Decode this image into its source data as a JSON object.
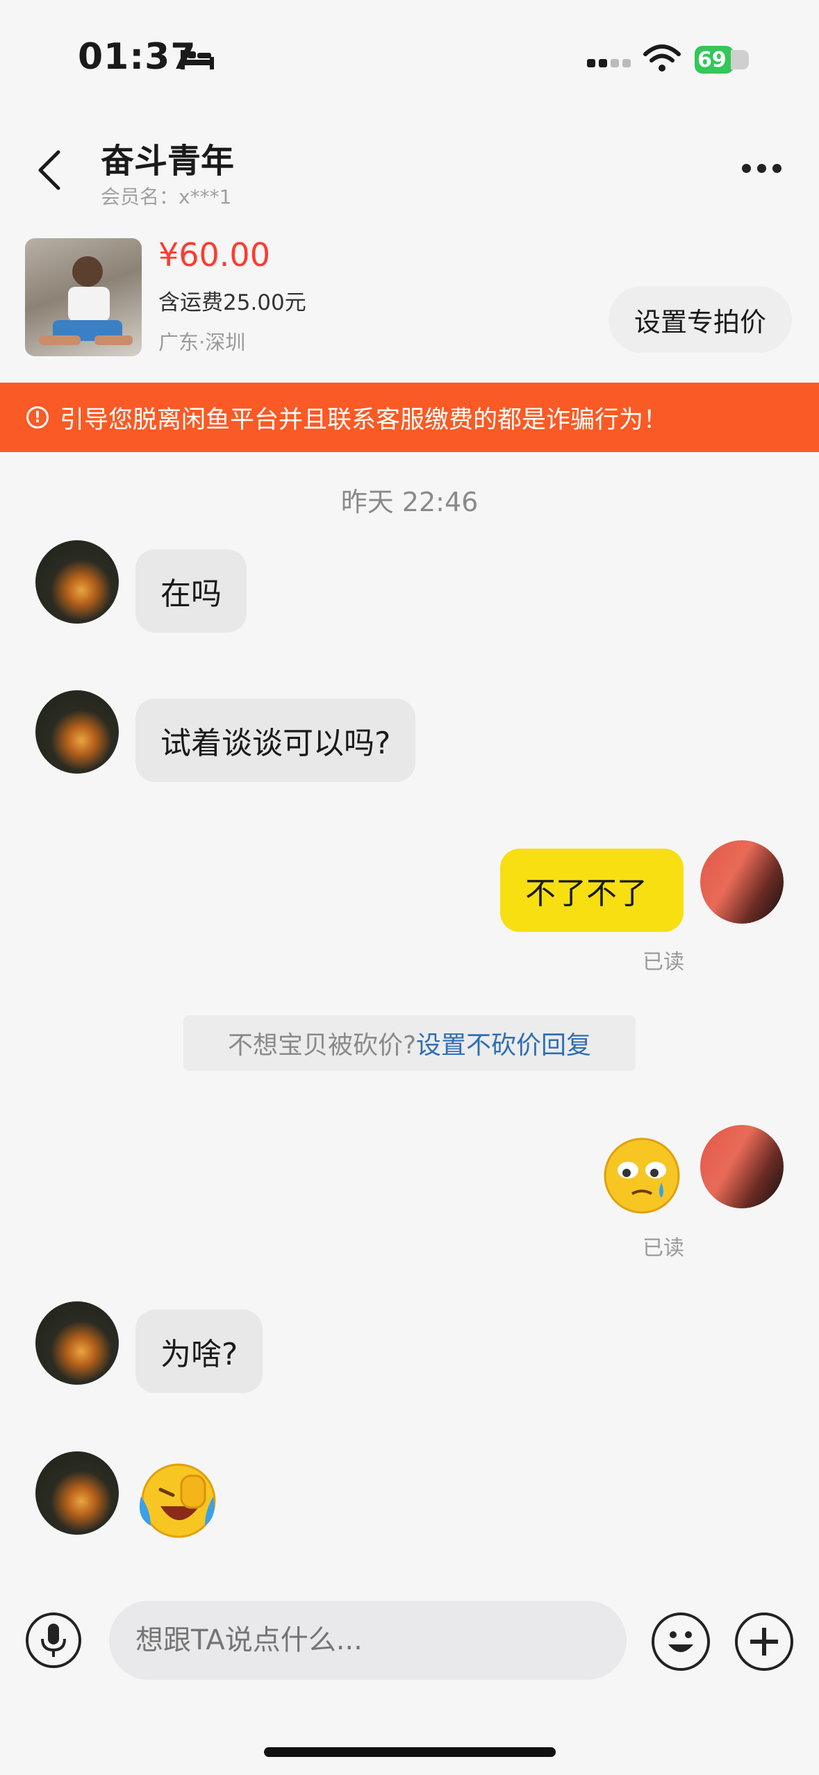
{
  "status_bar": {
    "time": "01:37",
    "battery": "69"
  },
  "header": {
    "title": "奋斗青年",
    "member_label": "会员名：x***1"
  },
  "product": {
    "price": "¥60.00",
    "shipping": "含运费25.00元",
    "location": "广东·深圳",
    "special_price_button": "设置专拍价"
  },
  "warning": {
    "text": "引导您脱离闲鱼平台并且联系客服缴费的都是诈骗行为！"
  },
  "chat": {
    "timestamp": "昨天 22:46",
    "messages": [
      {
        "side": "left",
        "text": "在吗"
      },
      {
        "side": "left",
        "text": "试着谈谈可以吗?"
      },
      {
        "side": "right",
        "text": "不了不了",
        "status": "已读"
      },
      {
        "side": "right",
        "emoji": "crying-face",
        "status": "已读"
      },
      {
        "side": "left",
        "text": "为啥?"
      },
      {
        "side": "left",
        "emoji": "laughing-tears-face"
      }
    ],
    "notice": {
      "text": "不想宝贝被砍价?",
      "link": "设置不砍价回复"
    }
  },
  "input": {
    "placeholder": "想跟TA说点什么..."
  },
  "colors": {
    "warning_bg": "#fa5a25",
    "price": "#ff3b30",
    "my_bubble": "#f8df12",
    "link": "#2f6db7"
  }
}
